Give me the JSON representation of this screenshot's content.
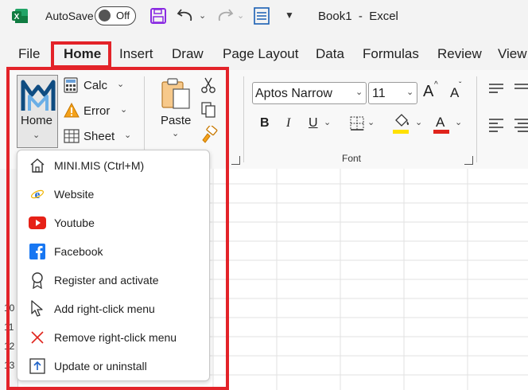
{
  "titlebar": {
    "autosave_label": "AutoSave",
    "toggle_state": "Off",
    "doc_title": "Book1  -  Excel"
  },
  "tabs": [
    "File",
    "Home",
    "Insert",
    "Draw",
    "Page Layout",
    "Data",
    "Formulas",
    "Review",
    "View"
  ],
  "ribbon": {
    "home_button": "Home",
    "calc_label": "Calc",
    "error_label": "Error",
    "sheet_label": "Sheet",
    "paste_label": "Paste",
    "font_name": "Aptos Narrow",
    "font_size": "11",
    "font_group_label": "Font",
    "bold": "B",
    "italic": "I",
    "underline": "U",
    "font_color_letter": "A",
    "grow_font": "A",
    "shrink_font": "A"
  },
  "menu": {
    "items": [
      {
        "label": "MINI.MIS (Ctrl+M)",
        "icon": "home-icon"
      },
      {
        "label": "Website",
        "icon": "browser-icon"
      },
      {
        "label": "Youtube",
        "icon": "youtube-icon"
      },
      {
        "label": "Facebook",
        "icon": "facebook-icon"
      },
      {
        "label": "Register and activate",
        "icon": "badge-icon"
      },
      {
        "label": "Add right-click menu",
        "icon": "cursor-icon"
      },
      {
        "label": "Remove right-click menu",
        "icon": "x-icon"
      },
      {
        "label": "Update or uninstall",
        "icon": "update-icon"
      }
    ]
  },
  "row_numbers": [
    "10",
    "11",
    "12",
    "13"
  ],
  "colors": {
    "highlight_red": "#e32329",
    "excel_green": "#107c41",
    "fill_yellow": "#ffe100",
    "font_red": "#e0241c"
  }
}
